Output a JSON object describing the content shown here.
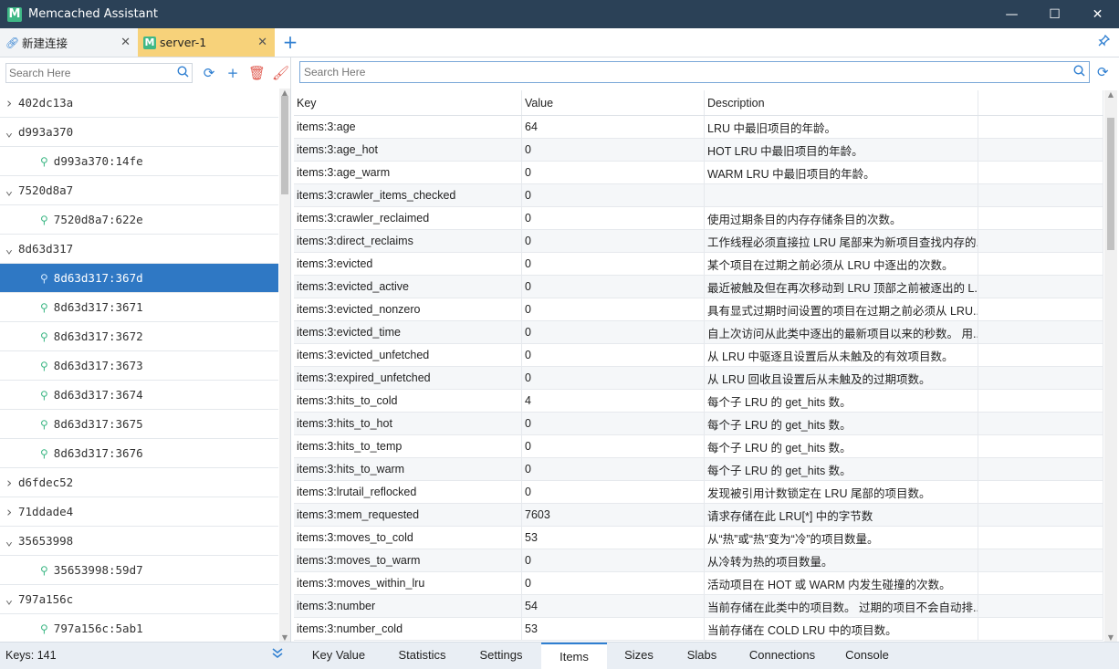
{
  "app": {
    "title": "Memcached Assistant",
    "logo_letter": "M"
  },
  "window": {
    "minimize": "—",
    "maximize": "☐",
    "close": "✕"
  },
  "tabs": [
    {
      "label": "新建连接",
      "icon": "link-icon",
      "close": "✕"
    },
    {
      "label": "server-1",
      "icon": "m-logo-icon",
      "close": "✕"
    }
  ],
  "tabbar": {
    "add": "+",
    "pin": "📌"
  },
  "left": {
    "search_placeholder": "Search Here",
    "tree": [
      {
        "label": "402dc13a",
        "type": "group",
        "expanded": false
      },
      {
        "label": "d993a370",
        "type": "group",
        "expanded": true
      },
      {
        "label": "d993a370:14fe",
        "type": "key"
      },
      {
        "label": "7520d8a7",
        "type": "group",
        "expanded": true
      },
      {
        "label": "7520d8a7:622e",
        "type": "key"
      },
      {
        "label": "8d63d317",
        "type": "group",
        "expanded": true
      },
      {
        "label": "8d63d317:367d",
        "type": "key",
        "selected": true
      },
      {
        "label": "8d63d317:3671",
        "type": "key"
      },
      {
        "label": "8d63d317:3672",
        "type": "key"
      },
      {
        "label": "8d63d317:3673",
        "type": "key"
      },
      {
        "label": "8d63d317:3674",
        "type": "key"
      },
      {
        "label": "8d63d317:3675",
        "type": "key"
      },
      {
        "label": "8d63d317:3676",
        "type": "key"
      },
      {
        "label": "d6fdec52",
        "type": "group",
        "expanded": false
      },
      {
        "label": "71ddade4",
        "type": "group",
        "expanded": false
      },
      {
        "label": "35653998",
        "type": "group",
        "expanded": true
      },
      {
        "label": "35653998:59d7",
        "type": "key"
      },
      {
        "label": "797a156c",
        "type": "group",
        "expanded": true
      },
      {
        "label": "797a156c:5ab1",
        "type": "key"
      }
    ]
  },
  "right": {
    "search_placeholder": "Search Here",
    "columns": [
      "Key",
      "Value",
      "Description",
      ""
    ],
    "rows": [
      [
        "items:3:age",
        "64",
        "LRU 中最旧项目的年龄。"
      ],
      [
        "items:3:age_hot",
        "0",
        "HOT LRU 中最旧项目的年龄。"
      ],
      [
        "items:3:age_warm",
        "0",
        "WARM LRU 中最旧项目的年龄。"
      ],
      [
        "items:3:crawler_items_checked",
        "0",
        ""
      ],
      [
        "items:3:crawler_reclaimed",
        "0",
        "使用过期条目的内存存储条目的次数。"
      ],
      [
        "items:3:direct_reclaims",
        "0",
        "工作线程必须直接拉 LRU 尾部来为新项目查找内存的..."
      ],
      [
        "items:3:evicted",
        "0",
        "某个项目在过期之前必须从 LRU 中逐出的次数。"
      ],
      [
        "items:3:evicted_active",
        "0",
        "最近被触及但在再次移动到 LRU 顶部之前被逐出的 L..."
      ],
      [
        "items:3:evicted_nonzero",
        "0",
        "具有显式过期时间设置的项目在过期之前必须从 LRU..."
      ],
      [
        "items:3:evicted_time",
        "0",
        "自上次访问从此类中逐出的最新项目以来的秒数。 用..."
      ],
      [
        "items:3:evicted_unfetched",
        "0",
        "从 LRU 中驱逐且设置后从未触及的有效项目数。"
      ],
      [
        "items:3:expired_unfetched",
        "0",
        "从 LRU 回收且设置后从未触及的过期项数。"
      ],
      [
        "items:3:hits_to_cold",
        "4",
        "每个子 LRU 的 get_hits 数。"
      ],
      [
        "items:3:hits_to_hot",
        "0",
        "每个子 LRU 的 get_hits 数。"
      ],
      [
        "items:3:hits_to_temp",
        "0",
        "每个子 LRU 的 get_hits 数。"
      ],
      [
        "items:3:hits_to_warm",
        "0",
        "每个子 LRU 的 get_hits 数。"
      ],
      [
        "items:3:lrutail_reflocked",
        "0",
        "发现被引用计数锁定在 LRU 尾部的项目数。"
      ],
      [
        "items:3:mem_requested",
        "7603",
        "请求存储在此 LRU[*] 中的字节数"
      ],
      [
        "items:3:moves_to_cold",
        "53",
        "从“热”或“热”变为“冷”的项目数量。"
      ],
      [
        "items:3:moves_to_warm",
        "0",
        "从冷转为热的项目数量。"
      ],
      [
        "items:3:moves_within_lru",
        "0",
        "活动项目在 HOT 或 WARM 内发生碰撞的次数。"
      ],
      [
        "items:3:number",
        "54",
        "当前存储在此类中的项目数。 过期的项目不会自动排..."
      ],
      [
        "items:3:number_cold",
        "53",
        "当前存储在 COLD LRU 中的项目数。"
      ]
    ]
  },
  "bottom": {
    "keys_label": "Keys: 141",
    "tabs": [
      "Key Value",
      "Statistics",
      "Settings",
      "Items",
      "Sizes",
      "Slabs",
      "Connections",
      "Console"
    ],
    "active_tab": "Items"
  },
  "colors": {
    "titlebar": "#2b4157",
    "accent": "#2f7fd1",
    "selected_row": "#2f78c4",
    "active_tab": "#f7d27a"
  }
}
